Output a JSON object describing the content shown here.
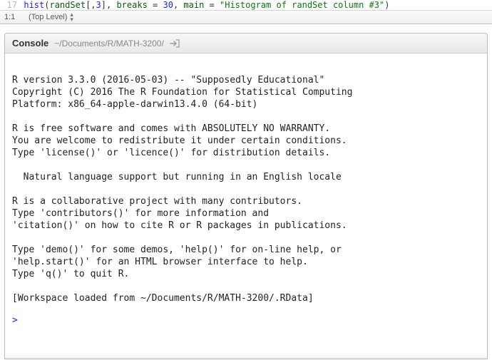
{
  "editor": {
    "line_number": "17",
    "code_raw": "hist(randSet[,3], breaks = 30, main = \"Histogram of randSet column #3\")",
    "status": {
      "cursor": "1:1",
      "scope": "(Top Level)"
    }
  },
  "console": {
    "header": {
      "title": "Console",
      "path": "~/Documents/R/MATH-3200/"
    },
    "output": "\nR version 3.3.0 (2016-05-03) -- \"Supposedly Educational\"\nCopyright (C) 2016 The R Foundation for Statistical Computing\nPlatform: x86_64-apple-darwin13.4.0 (64-bit)\n\nR is free software and comes with ABSOLUTELY NO WARRANTY.\nYou are welcome to redistribute it under certain conditions.\nType 'license()' or 'licence()' for distribution details.\n\n  Natural language support but running in an English locale\n\nR is a collaborative project with many contributors.\nType 'contributors()' for more information and\n'citation()' on how to cite R or R packages in publications.\n\nType 'demo()' for some demos, 'help()' for on-line help, or\n'help.start()' for an HTML browser interface to help.\nType 'q()' to quit R.\n\n[Workspace loaded from ~/Documents/R/MATH-3200/.RData]\n",
    "prompt": ">"
  }
}
